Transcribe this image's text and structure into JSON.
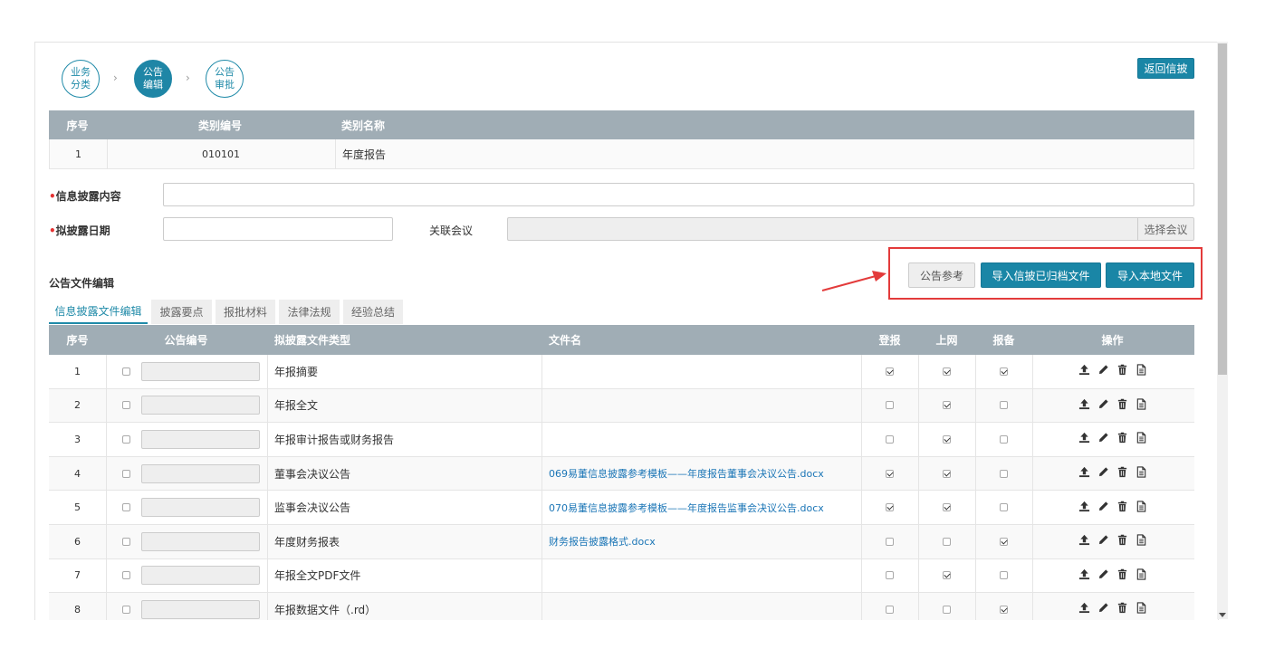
{
  "steps": [
    {
      "label": "业务\n分类",
      "active": false
    },
    {
      "label": "公告\n编辑",
      "active": true
    },
    {
      "label": "公告\n审批",
      "active": false
    }
  ],
  "step_arrow": "›",
  "return_button": "返回信披",
  "category_table": {
    "headers": [
      "序号",
      "类别编号",
      "类别名称"
    ],
    "row": [
      "1",
      "010101",
      "年度报告"
    ]
  },
  "form": {
    "content_label": "信息披露内容",
    "date_label": "拟披露日期",
    "meeting_label": "关联会议",
    "select_meeting_button": "选择会议",
    "required_mark": "•"
  },
  "section_title": "公告文件编辑",
  "action_buttons": {
    "reference": "公告参考",
    "import_archived": "导入信披已归档文件",
    "import_local": "导入本地文件"
  },
  "tabs": [
    "信息披露文件编辑",
    "披露要点",
    "报批材料",
    "法律法规",
    "经验总结"
  ],
  "file_table": {
    "headers": [
      "序号",
      "公告编号",
      "拟披露文件类型",
      "文件名",
      "登报",
      "上网",
      "报备",
      "操作"
    ],
    "rows": [
      {
        "no": "1",
        "type": "年报摘要",
        "file": "",
        "dengbao": true,
        "shangwang": true,
        "baobei": true
      },
      {
        "no": "2",
        "type": "年报全文",
        "file": "",
        "dengbao": false,
        "shangwang": true,
        "baobei": false
      },
      {
        "no": "3",
        "type": "年报审计报告或财务报告",
        "file": "",
        "dengbao": false,
        "shangwang": true,
        "baobei": false
      },
      {
        "no": "4",
        "type": "董事会决议公告",
        "file": "069易董信息披露参考模板——年度报告董事会决议公告.docx",
        "dengbao": true,
        "shangwang": true,
        "baobei": false
      },
      {
        "no": "5",
        "type": "监事会决议公告",
        "file": "070易董信息披露参考模板——年度报告监事会决议公告.docx",
        "dengbao": true,
        "shangwang": true,
        "baobei": false
      },
      {
        "no": "6",
        "type": "年度财务报表",
        "file": "财务报告披露格式.docx",
        "dengbao": false,
        "shangwang": false,
        "baobei": true
      },
      {
        "no": "7",
        "type": "年报全文PDF文件",
        "file": "",
        "dengbao": false,
        "shangwang": true,
        "baobei": false
      },
      {
        "no": "8",
        "type": "年报数据文件（.rd）",
        "file": "",
        "dengbao": false,
        "shangwang": false,
        "baobei": true
      }
    ]
  },
  "icons": [
    "upload-icon",
    "edit-icon",
    "delete-icon",
    "document-icon"
  ],
  "colors": {
    "primary": "#1a86a6",
    "header": "#a0adb5",
    "link": "#1a75b6",
    "annotation": "#e33b3b"
  }
}
